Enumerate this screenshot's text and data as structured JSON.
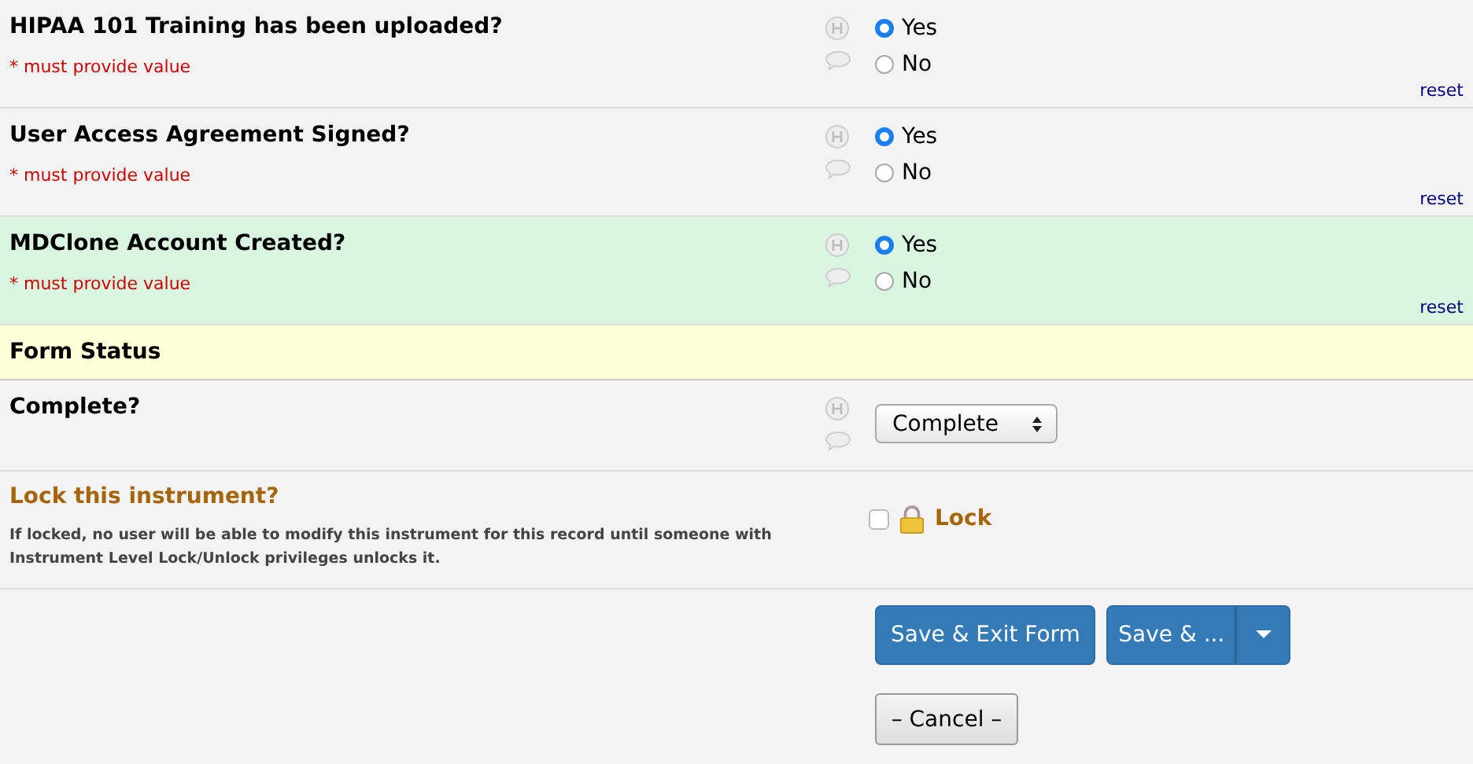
{
  "questions": [
    {
      "label": "HIPAA 101 Training has been uploaded?",
      "required_note": "* must provide value",
      "highlighted": false,
      "options": [
        {
          "label": "Yes",
          "selected": true
        },
        {
          "label": "No",
          "selected": false
        }
      ],
      "reset": "reset"
    },
    {
      "label": "User Access Agreement Signed?",
      "required_note": "* must provide value",
      "highlighted": false,
      "options": [
        {
          "label": "Yes",
          "selected": true
        },
        {
          "label": "No",
          "selected": false
        }
      ],
      "reset": "reset"
    },
    {
      "label": "MDClone Account Created?",
      "required_note": "* must provide value",
      "highlighted": true,
      "options": [
        {
          "label": "Yes",
          "selected": true
        },
        {
          "label": "No",
          "selected": false
        }
      ],
      "reset": "reset"
    }
  ],
  "form_status": {
    "header": "Form Status",
    "label": "Complete?",
    "value": "Complete"
  },
  "lock": {
    "title": "Lock this instrument?",
    "description": "If locked, no user will be able to modify this instrument for this record until someone with Instrument Level Lock/Unlock privileges unlocks it.",
    "checked": false,
    "label": "Lock"
  },
  "buttons": {
    "save_exit": "Save & Exit Form",
    "save_more": "Save & ...",
    "cancel": "– Cancel –"
  }
}
